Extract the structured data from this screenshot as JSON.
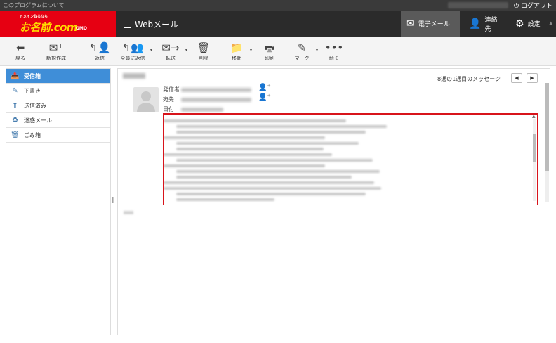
{
  "topbar": {
    "about": "このプログラムについて",
    "logout": "ログアウト"
  },
  "header": {
    "logo_tagline": "ドメイン取るなら",
    "logo_main": "お名前.com",
    "logo_sub": "GMO",
    "app_title": "Webメール",
    "nav": {
      "mail": "電子メール",
      "contacts": "連絡先",
      "settings": "設定"
    }
  },
  "toolbar": {
    "back": "戻る",
    "compose": "新規作成",
    "reply": "返信",
    "reply_all": "全員に返信",
    "forward": "転送",
    "delete": "削除",
    "move": "移動",
    "print": "印刷",
    "mark": "マーク",
    "more": "続く"
  },
  "sidebar": {
    "items": [
      {
        "label": "受信箱",
        "icon": "inbox-icon",
        "active": true
      },
      {
        "label": "下書き",
        "icon": "pencil-icon",
        "active": false
      },
      {
        "label": "送信済み",
        "icon": "sent-icon",
        "active": false
      },
      {
        "label": "迷惑メール",
        "icon": "spam-icon",
        "active": false
      },
      {
        "label": "ごみ箱",
        "icon": "trash-icon",
        "active": false
      }
    ]
  },
  "message": {
    "count": "8通の1通目のメッセージ",
    "prev": "◀",
    "next": "▶",
    "from_label": "発信者",
    "to_label": "宛先",
    "date_label": "日付"
  },
  "colors": {
    "brand_red": "#e60012",
    "active_blue": "#3f8ed8",
    "highlight_red": "#d8141b",
    "header_dark": "#2b2b2b"
  }
}
